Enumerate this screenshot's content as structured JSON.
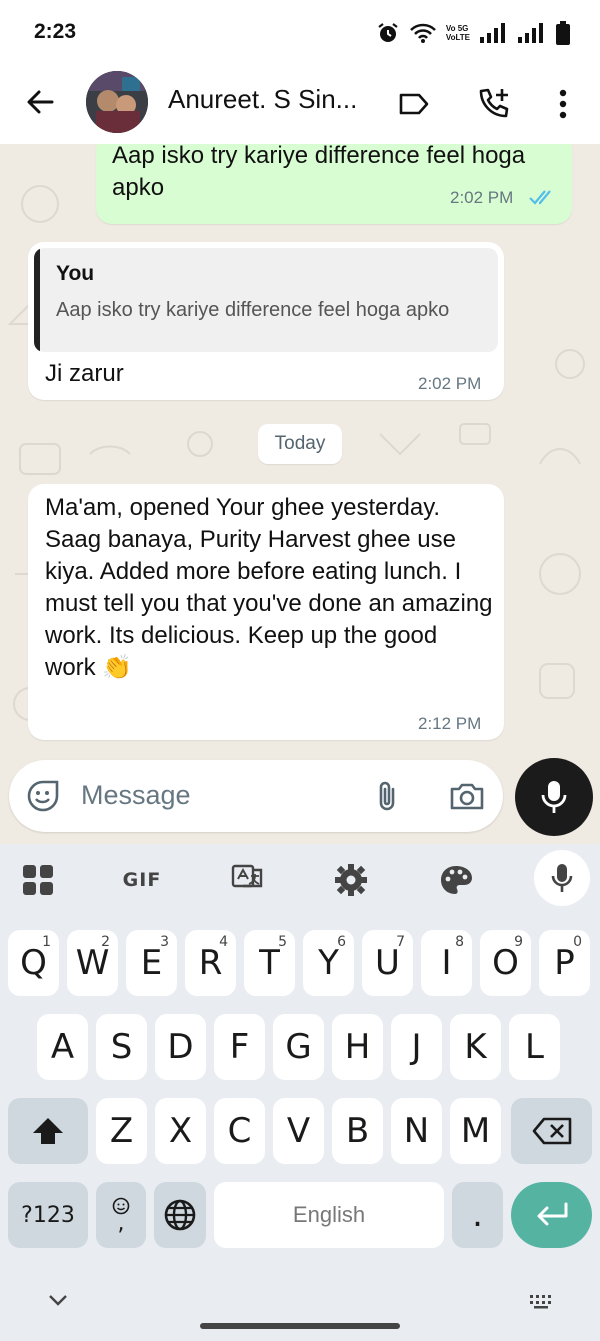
{
  "status_bar": {
    "time": "2:23",
    "network_badge_top": "Vo 5G",
    "network_badge_bottom": "VoLTE"
  },
  "header": {
    "contact_name": "Anureet. S Sin...",
    "icons": [
      "back-arrow-icon",
      "label-icon",
      "add-call-icon",
      "more-vert-icon"
    ]
  },
  "messages": [
    {
      "direction": "out",
      "text": "Aap isko try kariye difference feel hoga apko",
      "time": "2:02 PM",
      "status": "read"
    },
    {
      "direction": "in",
      "quoted_author": "You",
      "quoted_text": "Aap isko try kariye difference feel hoga apko",
      "text": "Ji zarur",
      "time": "2:02 PM"
    },
    {
      "direction": "in",
      "text": "Ma'am,  opened Your ghee yesterday. Saag banaya, Purity Harvest ghee use kiya. Added more before eating lunch. I must tell you that you've done an amazing work. Its delicious. Keep up the good work 👏",
      "time": "2:12 PM"
    }
  ],
  "date_separator": "Today",
  "composer": {
    "placeholder": "Message"
  },
  "keyboard": {
    "toolbar_gif": "GIF",
    "row1": [
      "Q",
      "W",
      "E",
      "R",
      "T",
      "Y",
      "U",
      "I",
      "O",
      "P"
    ],
    "row1_hints": [
      "1",
      "2",
      "3",
      "4",
      "5",
      "6",
      "7",
      "8",
      "9",
      "0"
    ],
    "row2": [
      "A",
      "S",
      "D",
      "F",
      "G",
      "H",
      "J",
      "K",
      "L"
    ],
    "row3": [
      "Z",
      "X",
      "C",
      "V",
      "B",
      "N",
      "M"
    ],
    "symbols_key": "?123",
    "comma_key": ",",
    "space_label": "English",
    "period_key": "."
  },
  "colors": {
    "outgoing_bubble": "#d9fdd3",
    "incoming_bubble": "#ffffff",
    "chat_background": "#efeae2",
    "read_ticks": "#53bdeb",
    "enter_key": "#55b3a2",
    "keyboard_bg": "#e9edf1"
  }
}
